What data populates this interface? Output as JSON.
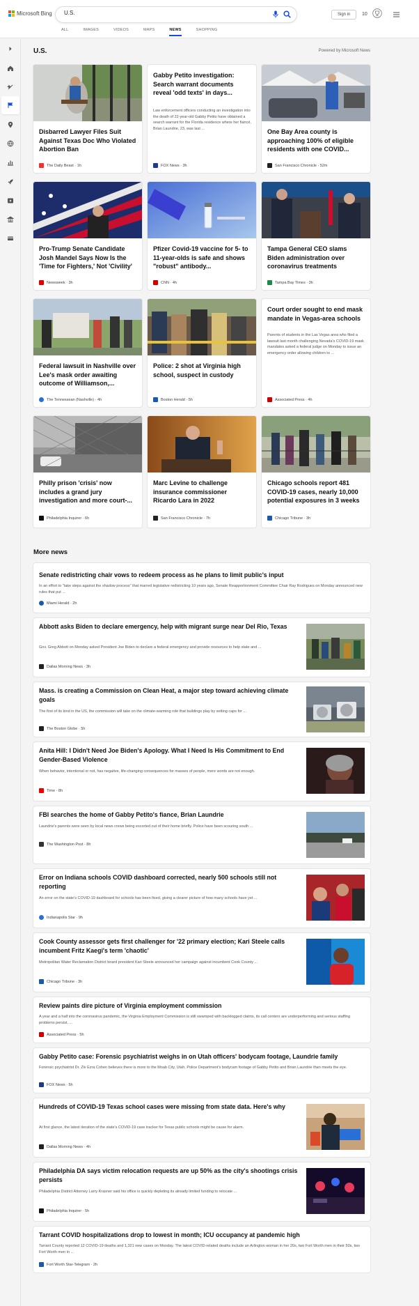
{
  "brand": {
    "name": "Microsoft Bing",
    "colors": [
      "#f25022",
      "#7fba00",
      "#00a4ef",
      "#ffb900"
    ]
  },
  "search": {
    "query": "U.S."
  },
  "header": {
    "signin": "Sign in",
    "rewards": "10"
  },
  "tabs": [
    "ALL",
    "IMAGES",
    "VIDEOS",
    "MAPS",
    "NEWS",
    "SHOPPING"
  ],
  "active_tab": "NEWS",
  "page": {
    "title": "U.S.",
    "powered": "Powered by Microsoft News"
  },
  "cards": [
    {
      "title": "Disbarred Lawyer Files Suit Against Texas Doc Who Violated Abortion Ban",
      "source": "The Daily Beast",
      "time": "1h",
      "fav": "#e23"
    },
    {
      "title": "Gabby Petito investigation: Search warrant documents reveal 'odd texts' in days...",
      "snippet": "Law enforcement officers conducting an investigation into the death of 22-year-old Gabby Petito have obtained a search warrant for the Florida residence where her fiancé, Brian Laundrie, 23, was last ...",
      "source": "FOX News",
      "time": "3h",
      "fav": "#1e3a8a"
    },
    {
      "title": "One Bay Area county is approaching 100% of eligible residents with one COVID...",
      "source": "San Francisco Chronicle",
      "time": "52m",
      "fav": "#222"
    },
    {
      "title": "Pro-Trump Senate Candidate Josh Mandel Says Now Is the 'Time for Fighters,' Not 'Civility'",
      "source": "Newsweek",
      "time": "3h",
      "fav": "#d00"
    },
    {
      "title": "Pfizer Covid-19 vaccine for 5- to 11-year-olds is safe and shows \"robust\" antibody...",
      "source": "CNN",
      "time": "4h",
      "fav": "#c00"
    },
    {
      "title": "Tampa General CEO slams Biden administration over coronavirus treatments",
      "source": "Tampa Bay Times",
      "time": "3h",
      "fav": "#1a8a4a"
    },
    {
      "title": "Federal lawsuit in Nashville over Lee's mask order awaiting outcome of Williamson,...",
      "source": "The Tennessean (Nashville)",
      "time": "4h",
      "fav": "#2a6fd6"
    },
    {
      "title": "Police: 2 shot at Virginia high school, suspect in custody",
      "source": "Boston Herald",
      "time": "5h",
      "fav": "#1b5aa8"
    },
    {
      "title": "Court order sought to end mask mandate in Vegas-area schools",
      "snippet": "Parents of students in the Las Vegas area who filed a lawsuit last month challenging Nevada's COVID-19 mask mandates asked a federal judge on Monday to issue an emergency order allowing children to ...",
      "source": "Associated Press",
      "time": "4h",
      "fav": "#c00"
    },
    {
      "title": "Philly prison 'crisis' now includes a grand jury investigation and more court-...",
      "source": "Philadelphia Inquirer",
      "time": "6h",
      "fav": "#111"
    },
    {
      "title": "Marc Levine to challenge insurance commissioner Ricardo Lara in 2022",
      "source": "San Francisco Chronicle",
      "time": "7h",
      "fav": "#222"
    },
    {
      "title": "Chicago schools report 481 COVID-19 cases, nearly 10,000 potential exposures in 3 weeks",
      "source": "Chicago Tribune",
      "time": "3h",
      "fav": "#1b5aa8"
    }
  ],
  "more": {
    "title": "More news",
    "items": [
      {
        "title": "Senate redistricting chair vows to redeem process as he plans to limit public's input",
        "snippet": "In an effort to \"take steps against the shadow process\" that marred legislative redistricting 10 years ago, Senate Reapportionment Committee Chair Ray Rodrigues on Monday announced new rules that put ...",
        "source": "Miami Herald",
        "time": "2h",
        "fav": "#1b5aa8"
      },
      {
        "title": "Abbott asks Biden to declare emergency, help with migrant surge near Del Rio, Texas",
        "snippet": "Gov. Greg Abbott on Monday asked President Joe Biden to declare a federal emergency and provide resources to help state and ...",
        "source": "Dallas Morning News",
        "time": "3h",
        "fav": "#222"
      },
      {
        "title": "Mass. is creating a Commission on Clean Heat, a major step toward achieving climate goals",
        "snippet": "The first of its kind in the US, the commission will take on the climate-warming role that buildings play by setting caps for ...",
        "source": "The Boston Globe",
        "time": "5h",
        "fav": "#222"
      },
      {
        "title": "Anita Hill: I Didn't Need Joe Biden's Apology. What I Need Is His Commitment to End Gender-Based Violence",
        "snippet": "When behavior, intentional or not, has negative, life-changing consequences for masses of people, mere words are not enough.",
        "source": "Time",
        "time": "8h",
        "fav": "#e00"
      },
      {
        "title": "FBI searches the home of Gabby Petito's fiance, Brian Laundrie",
        "snippet": "Laundrie's parents were seen by local news crews being escorted out of their home briefly. Police have been scouring south ...",
        "source": "The Washington Post",
        "time": "8h",
        "fav": "#333"
      },
      {
        "title": "Error on Indiana schools COVID dashboard corrected, nearly 500 schools still not reporting",
        "snippet": "An error on the state's COVID-19 dashboard for schools has been fixed, giving a clearer picture of how many schools have yet ...",
        "source": "Indianapolis Star",
        "time": "9h",
        "fav": "#2a6fd6"
      },
      {
        "title": "Cook County assessor gets first challenger for '22 primary election; Kari Steele calls incumbent Fritz Kaegi's term 'chaotic'",
        "snippet": "Metropolitan Water Reclamation District board president Kari Steele announced her campaign against incumbent Cook County ...",
        "source": "Chicago Tribune",
        "time": "3h",
        "fav": "#1b5aa8"
      },
      {
        "title": "Review paints dire picture of Virginia employment commission",
        "snippet": "A year and a half into the coronavirus pandemic, the Virginia Employment Commission is still swamped with backlogged claims, its call centers are underperforming and serious staffing problems persist, ...",
        "source": "Associated Press",
        "time": "5h",
        "fav": "#c00"
      },
      {
        "title": "Gabby Petito case: Forensic psychiatrist weighs in on Utah officers' bodycam footage, Laundrie family",
        "snippet": "Forensic psychiatrist Dr. Ziv Ezra Cohen believes there is more to the Moab City, Utah, Police Department's bodycam footage of Gabby Petito and Brian Laundrie than meets the eye.",
        "source": "FOX News",
        "time": "5h",
        "fav": "#1e3a8a"
      },
      {
        "title": "Hundreds of COVID-19 Texas school cases were missing from state data. Here's why",
        "snippet": "At first glance, the latest iteration of the state's COVID-19 case tracker for Texas public schools might be cause for alarm.",
        "source": "Dallas Morning News",
        "time": "4h",
        "fav": "#222"
      },
      {
        "title": "Philadelphia DA says victim relocation requests are up 50% as the city's shootings crisis persists",
        "snippet": "Philadelphia District Attorney Larry Krasner said his office is quickly depleting its already limited funding to relocate ...",
        "source": "Philadelphia Inquirer",
        "time": "5h",
        "fav": "#111"
      },
      {
        "title": "Tarrant COVID hospitalizations drop to lowest in month; ICU occupancy at pandemic high",
        "snippet": "Tarrant County reported 12 COVID-19 deaths and 1,321 new cases on Monday. The latest COVID-related deaths include an Arlington woman in her 20s, two Fort Worth men in their 50s, two Fort Worth men in ...",
        "source": "Fort Worth Star-Telegram",
        "time": "2h",
        "fav": "#1b5aa8"
      }
    ]
  }
}
